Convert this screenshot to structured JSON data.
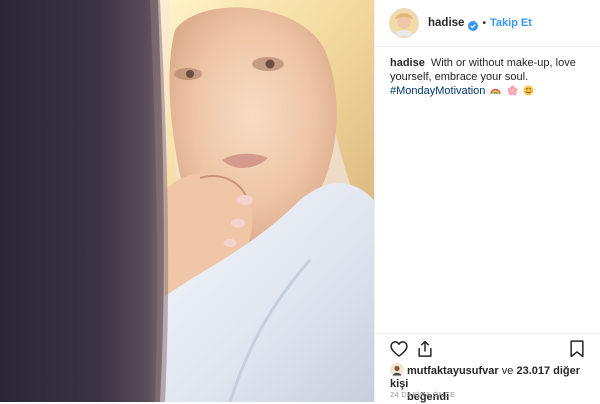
{
  "post": {
    "username": "hadise",
    "follow_label": "Takip Et",
    "dot_separator": "•",
    "caption_username": "hadise",
    "caption_text": "With or without make-up, love yourself, embrace your soul.",
    "hashtag": "#MondayMotivation",
    "caption_emojis": [
      "rainbow-icon",
      "cherry-blossom-icon",
      "smiling-face-icon"
    ],
    "liker_username": "mutfaktayusufvar",
    "likes_connector": "ve",
    "likes_others": "23.017 diğer kişi",
    "likes_suffix": "beğendi",
    "timestamp": "24 DAKİKA ÖNCE"
  },
  "icons": {
    "like": "heart-icon",
    "share": "share-icon",
    "save": "bookmark-icon",
    "verified": "verified-badge-icon"
  },
  "colors": {
    "follow_blue": "#3897f0",
    "verified_blue": "#3897f0",
    "text_dark": "#262626",
    "text_muted": "#999999",
    "hashtag": "#003569",
    "divider": "#efefef"
  }
}
